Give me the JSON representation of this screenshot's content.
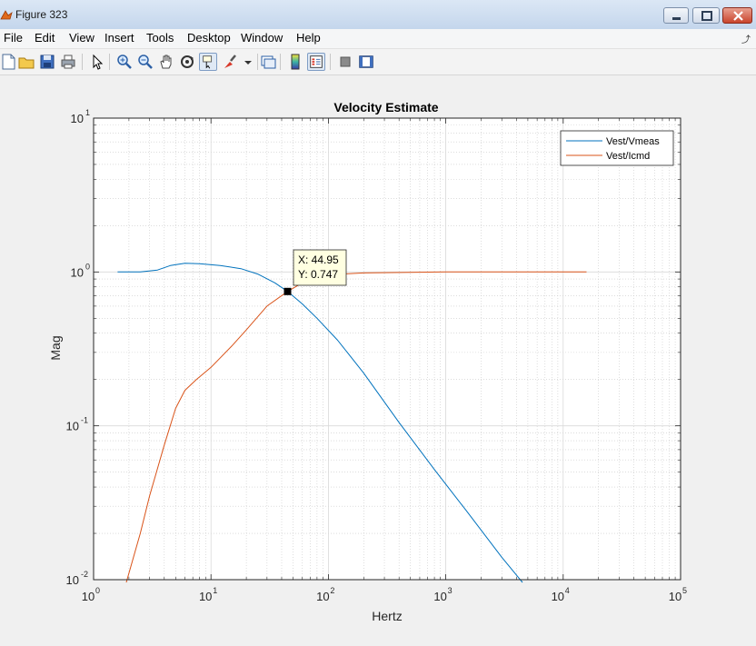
{
  "window": {
    "title": "Figure 323"
  },
  "menu": {
    "items": [
      "File",
      "Edit",
      "View",
      "Insert",
      "Tools",
      "Desktop",
      "Window",
      "Help"
    ]
  },
  "toolbar": {
    "icons": [
      "new-figure-icon",
      "open-file-icon",
      "save-icon",
      "print-icon",
      "edit-plot-icon",
      "zoom-in-icon",
      "zoom-out-icon",
      "pan-icon",
      "rotate-3d-icon",
      "data-cursor-icon",
      "brush-icon",
      "link-plot-icon",
      "insert-colorbar-icon",
      "insert-legend-icon",
      "hide-plot-tools-icon",
      "show-plot-tools-icon"
    ]
  },
  "chart_data": {
    "type": "line",
    "title": "Velocity Estimate",
    "xlabel": "Hertz",
    "ylabel": "Mag",
    "xscale": "log",
    "yscale": "log",
    "xlim": [
      1,
      100000
    ],
    "ylim": [
      0.01,
      10
    ],
    "x_ticks": [
      {
        "base": "10",
        "exp": "0"
      },
      {
        "base": "10",
        "exp": "1"
      },
      {
        "base": "10",
        "exp": "2"
      },
      {
        "base": "10",
        "exp": "3"
      },
      {
        "base": "10",
        "exp": "4"
      },
      {
        "base": "10",
        "exp": "5"
      }
    ],
    "y_ticks": [
      {
        "base": "10",
        "exp": "-2"
      },
      {
        "base": "10",
        "exp": "-1"
      },
      {
        "base": "10",
        "exp": "0"
      },
      {
        "base": "10",
        "exp": "1"
      }
    ],
    "grid": true,
    "minor_grid": true,
    "legend_position": "top-right",
    "series": [
      {
        "name": "Vest/Vmeas",
        "color": "#0072bd",
        "points": [
          [
            1.6,
            1.0
          ],
          [
            2.5,
            1.0
          ],
          [
            3.5,
            1.03
          ],
          [
            4.5,
            1.1
          ],
          [
            6,
            1.14
          ],
          [
            8,
            1.13
          ],
          [
            12,
            1.1
          ],
          [
            18,
            1.05
          ],
          [
            25,
            0.97
          ],
          [
            35,
            0.85
          ],
          [
            44.95,
            0.747
          ],
          [
            60,
            0.62
          ],
          [
            80,
            0.5
          ],
          [
            120,
            0.36
          ],
          [
            200,
            0.22
          ],
          [
            400,
            0.105
          ],
          [
            800,
            0.052
          ],
          [
            1500,
            0.028
          ],
          [
            3000,
            0.014
          ],
          [
            4500,
            0.0096
          ]
        ]
      },
      {
        "name": "Vest/Icmd",
        "color": "#d95319",
        "points": [
          [
            1.9,
            0.0096
          ],
          [
            2.5,
            0.02
          ],
          [
            3,
            0.035
          ],
          [
            4,
            0.075
          ],
          [
            5,
            0.13
          ],
          [
            6,
            0.17
          ],
          [
            7.5,
            0.2
          ],
          [
            10,
            0.24
          ],
          [
            15,
            0.33
          ],
          [
            20,
            0.42
          ],
          [
            30,
            0.6
          ],
          [
            44.95,
            0.747
          ],
          [
            60,
            0.85
          ],
          [
            80,
            0.92
          ],
          [
            100,
            0.96
          ],
          [
            200,
            0.985
          ],
          [
            500,
            0.995
          ],
          [
            1000,
            1.0
          ],
          [
            5000,
            1.0
          ],
          [
            15800,
            1.0
          ]
        ]
      }
    ],
    "datatip": {
      "x": 44.95,
      "y": 0.747,
      "x_label": "X: 44.95",
      "y_label": "Y: 0.747"
    }
  }
}
